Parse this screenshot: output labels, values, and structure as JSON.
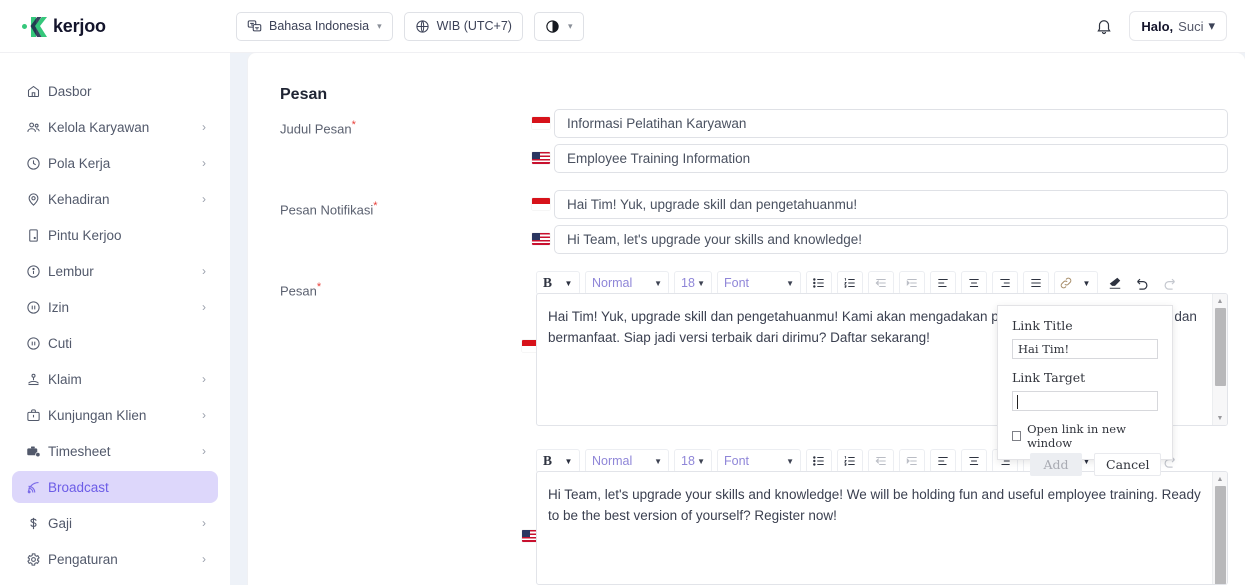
{
  "brand": {
    "name": "kerjoo",
    "accent": "#6c5ce7",
    "green": "#35c77b",
    "dark": "#13142b"
  },
  "topbar": {
    "language": {
      "label": "Bahasa Indonesia",
      "icon": "translate-icon"
    },
    "timezone": {
      "label": "WIB (UTC+7)",
      "icon": "globe-icon"
    },
    "theme": {
      "label": "",
      "icon": "contrast-icon"
    },
    "notifications_icon": "bell-icon",
    "user": {
      "greeting": "Halo,",
      "name": "Suci"
    }
  },
  "sidebar": {
    "items": [
      {
        "label": "Dasbor",
        "icon": "home-icon",
        "expandable": false,
        "active": false
      },
      {
        "label": "Kelola Karyawan",
        "icon": "users-icon",
        "expandable": true,
        "active": false
      },
      {
        "label": "Pola Kerja",
        "icon": "clock-icon",
        "expandable": true,
        "active": false
      },
      {
        "label": "Kehadiran",
        "icon": "location-pin-icon",
        "expandable": true,
        "active": false
      },
      {
        "label": "Pintu Kerjoo",
        "icon": "door-icon",
        "expandable": false,
        "active": false
      },
      {
        "label": "Lembur",
        "icon": "info-icon",
        "expandable": true,
        "active": false
      },
      {
        "label": "Izin",
        "icon": "pause-icon",
        "expandable": true,
        "active": false
      },
      {
        "label": "Cuti",
        "icon": "pause-icon",
        "expandable": false,
        "active": false
      },
      {
        "label": "Klaim",
        "icon": "hand-coin-icon",
        "expandable": true,
        "active": false
      },
      {
        "label": "Kunjungan Klien",
        "icon": "briefcase-icon",
        "expandable": true,
        "active": false
      },
      {
        "label": "Timesheet",
        "icon": "timesheet-icon",
        "expandable": true,
        "active": false
      },
      {
        "label": "Broadcast",
        "icon": "broadcast-icon",
        "expandable": false,
        "active": true
      },
      {
        "label": "Gaji",
        "icon": "dollar-icon",
        "expandable": true,
        "active": false
      },
      {
        "label": "Pengaturan",
        "icon": "gear-icon",
        "expandable": true,
        "active": false
      }
    ]
  },
  "main": {
    "section_title": "Pesan",
    "fields": {
      "judul_pesan": {
        "label": "Judul Pesan",
        "required_mark": "*",
        "id_value": "Informasi Pelatihan Karyawan",
        "en_value": "Employee Training Information"
      },
      "pesan_notifikasi": {
        "label": "Pesan Notifikasi",
        "required_mark": "*",
        "id_value": "Hai Tim!  Yuk, upgrade skill dan pengetahuanmu!",
        "en_value": "Hi Team, let's upgrade your skills and knowledge!"
      },
      "pesan": {
        "label": "Pesan",
        "required_mark": "*",
        "id_body": "Hai Tim!  Yuk, upgrade skill dan pengetahuanmu! Kami akan mengadakan pelatihan karyawan yang seru dan bermanfaat. Siap jadi versi terbaik dari dirimu? Daftar sekarang!",
        "en_body": "Hi Team, let's upgrade your skills and knowledge! We will be holding fun and useful employee training. Ready to be the best version of yourself? Register now!"
      }
    },
    "editor_toolbar": {
      "bold": "B",
      "heading_select": "Normal",
      "size_select": "18",
      "font_select": "Font",
      "buttons": [
        {
          "name": "bullet-list-icon"
        },
        {
          "name": "numbered-list-icon"
        },
        {
          "name": "outdent-icon"
        },
        {
          "name": "indent-icon"
        },
        {
          "name": "align-left-icon"
        },
        {
          "name": "align-center-icon"
        },
        {
          "name": "align-right-icon"
        },
        {
          "name": "align-justify-icon"
        },
        {
          "name": "link-icon"
        },
        {
          "name": "eraser-icon"
        },
        {
          "name": "undo-icon"
        },
        {
          "name": "redo-icon"
        }
      ]
    }
  },
  "link_popup": {
    "title_label": "Link Title",
    "title_value": "Hai Tim!",
    "target_label": "Link Target",
    "target_value": "",
    "checkbox_label": "Open link in new window",
    "checkbox_checked": false,
    "add_label": "Add",
    "cancel_label": "Cancel"
  }
}
